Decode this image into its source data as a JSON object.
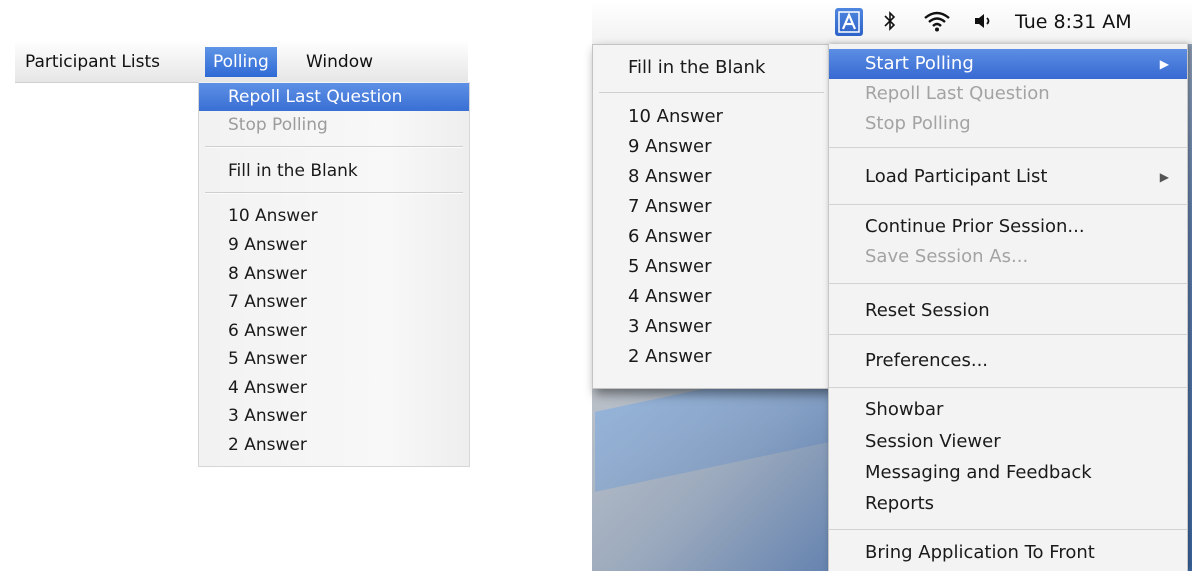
{
  "left": {
    "menubar": [
      {
        "label": "Participant Lists",
        "active": false
      },
      {
        "label": "Polling",
        "active": true
      },
      {
        "label": "Window",
        "active": false
      }
    ],
    "menu": {
      "repoll": "Repoll Last Question",
      "stop": "Stop Polling",
      "fill_blank": "Fill in the Blank",
      "answers": [
        "10 Answer",
        "9 Answer",
        "8 Answer",
        "7 Answer",
        "6 Answer",
        "5 Answer",
        "4 Answer",
        "3 Answer",
        "2 Answer"
      ]
    }
  },
  "right": {
    "status_bar": {
      "app_icon_letter": "A",
      "bluetooth_glyph": "✱",
      "wifi_icon": "wifi-icon",
      "volume_glyph": "◀)",
      "clock": "Tue 8:31 AM"
    },
    "submenu": {
      "fill_blank": "Fill in the Blank",
      "answers": [
        "10 Answer",
        "9 Answer",
        "8 Answer",
        "7 Answer",
        "6 Answer",
        "5 Answer",
        "4 Answer",
        "3 Answer",
        "2 Answer"
      ]
    },
    "menu": {
      "start_polling": "Start Polling",
      "repoll": "Repoll Last Question",
      "stop": "Stop Polling",
      "load_list": "Load Participant List",
      "continue": "Continue Prior Session...",
      "save_as": "Save Session As...",
      "reset": "Reset Session",
      "preferences": "Preferences...",
      "showbar": "Showbar",
      "session_viewer": "Session Viewer",
      "messaging": "Messaging and Feedback",
      "reports": "Reports",
      "bring_front": "Bring Application To Front",
      "submenu_arrow": "▶"
    }
  },
  "colors": {
    "selection": "#3a6fd4",
    "disabled_text": "#a0a0a0"
  }
}
